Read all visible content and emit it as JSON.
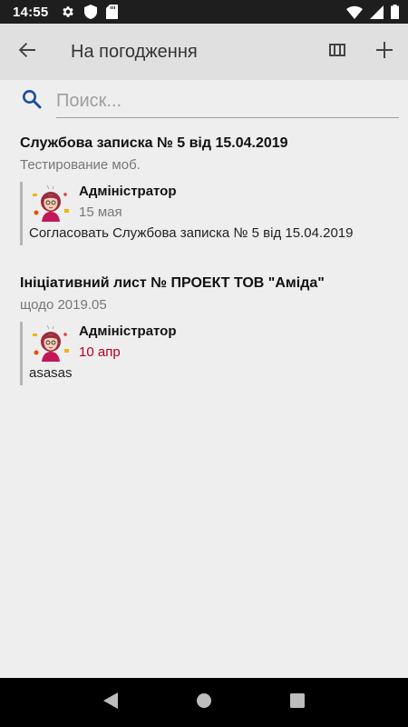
{
  "status_bar": {
    "time": "14:55",
    "icons_left": [
      "gear-icon",
      "shield-icon",
      "sd-card-icon"
    ],
    "icons_right": [
      "wifi-icon",
      "signal-icon",
      "battery-icon"
    ]
  },
  "app_bar": {
    "title": "На погодження",
    "back_icon": "arrow-back-icon",
    "actions": [
      "columns-icon",
      "add-icon"
    ]
  },
  "search": {
    "placeholder": "Поиск...",
    "value": ""
  },
  "documents": [
    {
      "title": "Службова записка № 5 від 15.04.2019",
      "subtitle": "Тестирование моб.",
      "comment": {
        "author": "Адміністратор",
        "date": "15 мая",
        "text": "Согласовать Службова записка № 5 від 15.04.2019"
      }
    },
    {
      "title": "Ініціативний лист № ПРОЕКТ ТОВ \"Аміда\"",
      "subtitle": "щодо 2019.05",
      "comment": {
        "author": "Адміністратор",
        "date": "10 апр",
        "text": "asasas"
      }
    }
  ],
  "colors": {
    "accent": "#1a4d9c",
    "recent_date": "#b00020",
    "app_bar": "#e0e0e0",
    "background": "#eeeeee"
  },
  "nav_bar": {
    "buttons": [
      "back-triangle-icon",
      "home-circle-icon",
      "recents-square-icon"
    ]
  }
}
